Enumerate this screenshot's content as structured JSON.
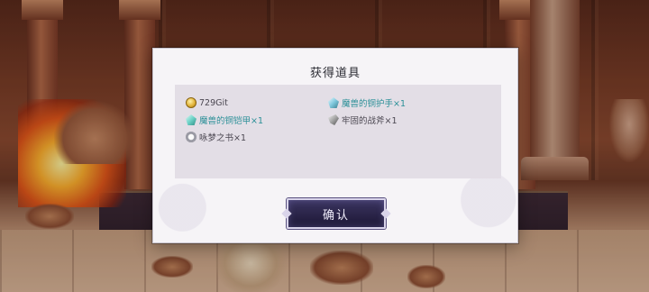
{
  "dialog": {
    "title": "获得道具",
    "confirm_label": "确认"
  },
  "items": [
    {
      "name": "729Git",
      "icon": "gold-coin-icon",
      "color": "#4a4650"
    },
    {
      "name": "魔兽的铜护手×1",
      "icon": "green-gem-icon",
      "color": "#2a8f97"
    },
    {
      "name": "魔兽的铜铠甲×1",
      "icon": "green-gem-icon",
      "color": "#2a8f97"
    },
    {
      "name": "牢固的战斧×1",
      "icon": "axe-icon",
      "color": "#4a4650"
    },
    {
      "name": "咏梦之书×1",
      "icon": "book-icon",
      "color": "#4a4650"
    }
  ],
  "colors": {
    "accent_rare": "#2a8f97",
    "button_bg": "#2a2448",
    "dialog_bg": "#f6f4f7"
  }
}
